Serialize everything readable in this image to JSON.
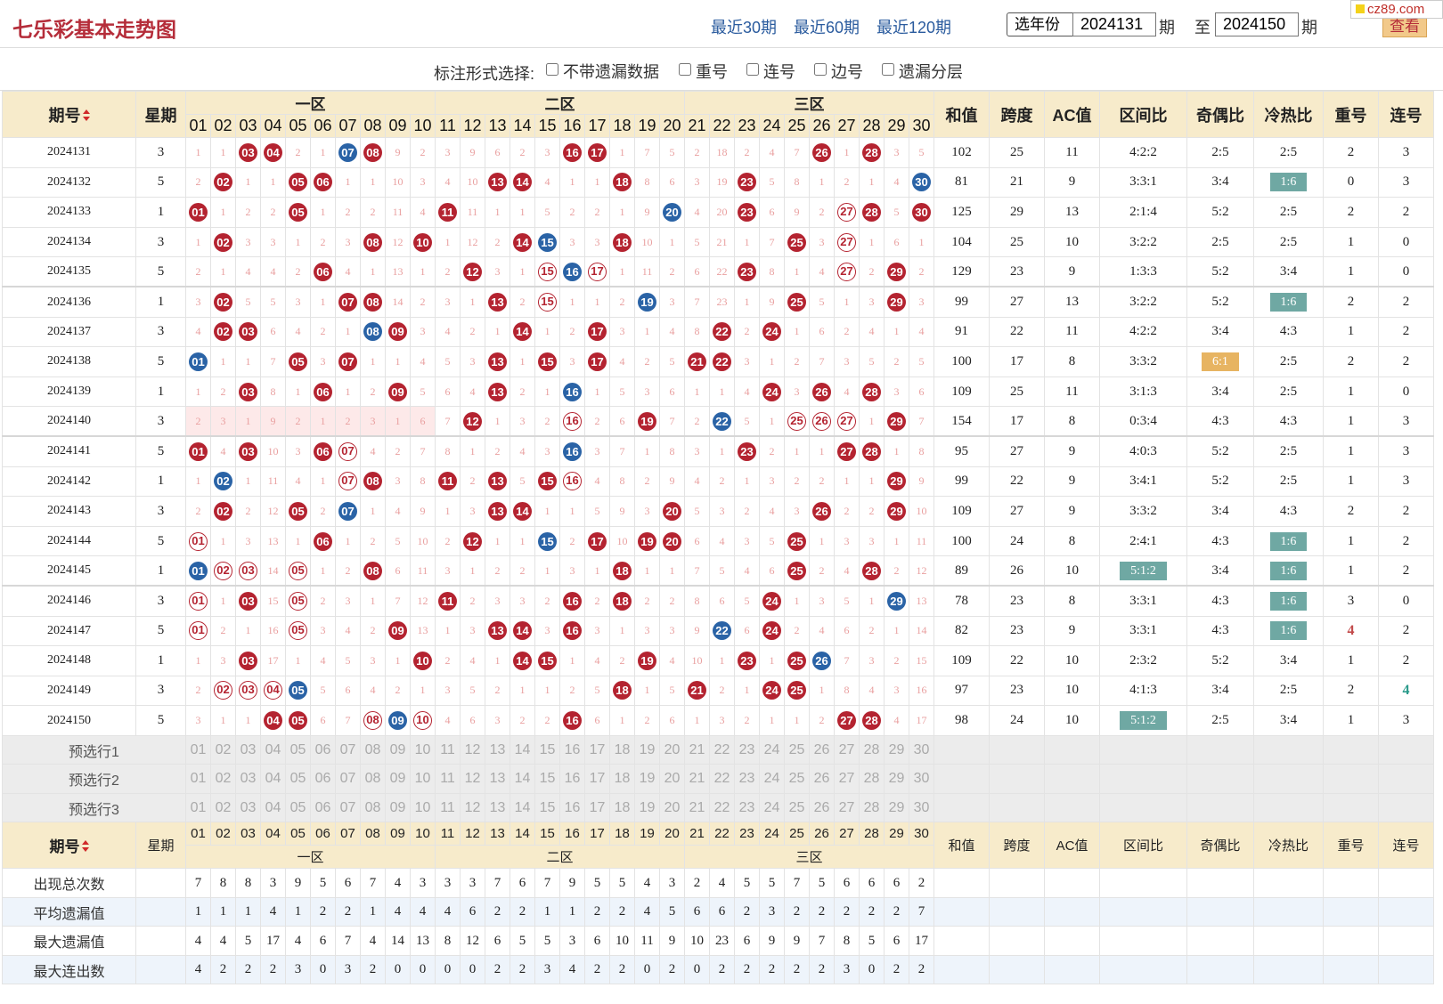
{
  "header": {
    "title": "七乐彩基本走势图",
    "link30": "最近30期",
    "link60": "最近60期",
    "link120": "最近120期",
    "year_select": "选年份",
    "from_period": "2024131",
    "period_label": "期",
    "to_label": "至",
    "to_period": "2024150",
    "period_label2": "期",
    "query_button": "查看",
    "watermark": "cz89.com"
  },
  "options": {
    "label": "标注形式选择:",
    "items": [
      "不带遗漏数据",
      "重号",
      "连号",
      "边号",
      "遗漏分层"
    ]
  },
  "table": {
    "h_period": "期号",
    "h_week": "星期",
    "zones": [
      "一区",
      "二区",
      "三区"
    ],
    "h_stats": [
      "和值",
      "跨度",
      "AC值",
      "区间比",
      "奇偶比",
      "冷热比",
      "重号",
      "连号"
    ],
    "nums": [
      "01",
      "02",
      "03",
      "04",
      "05",
      "06",
      "07",
      "08",
      "09",
      "10",
      "11",
      "12",
      "13",
      "14",
      "15",
      "16",
      "17",
      "18",
      "19",
      "20",
      "21",
      "22",
      "23",
      "24",
      "25",
      "26",
      "27",
      "28",
      "29",
      "30"
    ],
    "rows": [
      {
        "p": "2024131",
        "w": "3",
        "c": [
          "1",
          "1",
          "r03",
          "r04",
          "2",
          "1",
          "b07",
          "r08",
          "9",
          "2",
          "3",
          "9",
          "6",
          "2",
          "3",
          "r16",
          "r17",
          "1",
          "7",
          "5",
          "2",
          "18",
          "2",
          "4",
          "7",
          "r26",
          "1",
          "r28",
          "3",
          "5"
        ],
        "s": [
          "102",
          "25",
          "11",
          "4:2:2",
          "2:5",
          "2:5",
          "2",
          "3"
        ]
      },
      {
        "p": "2024132",
        "w": "5",
        "c": [
          "2",
          "r02",
          "1",
          "1",
          "r05",
          "r06",
          "1",
          "1",
          "10",
          "3",
          "4",
          "10",
          "r13",
          "r14",
          "4",
          "1",
          "1",
          "r18",
          "8",
          "6",
          "3",
          "19",
          "r23",
          "5",
          "8",
          "1",
          "2",
          "1",
          "4",
          "b30"
        ],
        "s": [
          "81",
          "21",
          "9",
          "3:3:1",
          "3:4",
          "t1:6",
          "0",
          "3"
        ]
      },
      {
        "p": "2024133",
        "w": "1",
        "c": [
          "r01",
          "1",
          "2",
          "2",
          "r05",
          "1",
          "2",
          "2",
          "11",
          "4",
          "r11",
          "11",
          "1",
          "1",
          "5",
          "2",
          "2",
          "1",
          "9",
          "b20",
          "4",
          "20",
          "r23",
          "6",
          "9",
          "2",
          "o27",
          "r28",
          "5",
          "r30"
        ],
        "s": [
          "125",
          "29",
          "13",
          "2:1:4",
          "5:2",
          "2:5",
          "2",
          "2"
        ]
      },
      {
        "p": "2024134",
        "w": "3",
        "c": [
          "1",
          "r02",
          "3",
          "3",
          "1",
          "2",
          "3",
          "r08",
          "12",
          "r10",
          "1",
          "12",
          "2",
          "r14",
          "b15",
          "3",
          "3",
          "r18",
          "10",
          "1",
          "5",
          "21",
          "1",
          "7",
          "r25",
          "3",
          "o27",
          "1",
          "6",
          "1"
        ],
        "s": [
          "104",
          "25",
          "10",
          "3:2:2",
          "2:5",
          "2:5",
          "1",
          "0"
        ]
      },
      {
        "p": "2024135",
        "w": "5",
        "c": [
          "2",
          "1",
          "4",
          "4",
          "2",
          "r06",
          "4",
          "1",
          "13",
          "1",
          "2",
          "r12",
          "3",
          "1",
          "o15",
          "b16",
          "o17",
          "1",
          "11",
          "2",
          "6",
          "22",
          "r23",
          "8",
          "1",
          "4",
          "o27",
          "2",
          "r29",
          "2"
        ],
        "s": [
          "129",
          "23",
          "9",
          "1:3:3",
          "5:2",
          "3:4",
          "1",
          "0"
        ]
      },
      {
        "p": "2024136",
        "w": "1",
        "c": [
          "3",
          "r02",
          "5",
          "5",
          "3",
          "1",
          "r07",
          "r08",
          "14",
          "2",
          "3",
          "1",
          "r13",
          "2",
          "o15",
          "1",
          "1",
          "2",
          "b19",
          "3",
          "7",
          "23",
          "1",
          "9",
          "r25",
          "5",
          "1",
          "3",
          "r29",
          "3"
        ],
        "s": [
          "99",
          "27",
          "13",
          "3:2:2",
          "5:2",
          "t1:6",
          "2",
          "2"
        ]
      },
      {
        "p": "2024137",
        "w": "3",
        "c": [
          "4",
          "r02",
          "r03",
          "6",
          "4",
          "2",
          "1",
          "b08",
          "r09",
          "3",
          "4",
          "2",
          "1",
          "r14",
          "1",
          "2",
          "r17",
          "3",
          "1",
          "4",
          "8",
          "r22",
          "2",
          "r24",
          "1",
          "6",
          "2",
          "4",
          "1",
          "4"
        ],
        "s": [
          "91",
          "22",
          "11",
          "4:2:2",
          "3:4",
          "4:3",
          "1",
          "2"
        ]
      },
      {
        "p": "2024138",
        "w": "5",
        "c": [
          "b01",
          "1",
          "1",
          "7",
          "r05",
          "3",
          "r07",
          "1",
          "1",
          "4",
          "5",
          "3",
          "r13",
          "1",
          "r15",
          "3",
          "r17",
          "4",
          "2",
          "5",
          "r21",
          "r22",
          "3",
          "1",
          "2",
          "7",
          "3",
          "5",
          "2",
          "5"
        ],
        "s": [
          "100",
          "17",
          "8",
          "3:3:2",
          "y6:1",
          "2:5",
          "2",
          "2"
        ]
      },
      {
        "p": "2024139",
        "w": "1",
        "c": [
          "1",
          "2",
          "r03",
          "8",
          "1",
          "r06",
          "1",
          "2",
          "r09",
          "5",
          "6",
          "4",
          "r13",
          "2",
          "1",
          "b16",
          "1",
          "5",
          "3",
          "6",
          "1",
          "1",
          "4",
          "r24",
          "3",
          "r26",
          "4",
          "r28",
          "3",
          "6"
        ],
        "s": [
          "109",
          "25",
          "11",
          "3:1:3",
          "3:4",
          "2:5",
          "1",
          "0"
        ]
      },
      {
        "p": "2024140",
        "w": "3",
        "h": true,
        "c": [
          "2",
          "3",
          "1",
          "9",
          "2",
          "1",
          "2",
          "3",
          "1",
          "6",
          "7",
          "r12",
          "1",
          "3",
          "2",
          "o16",
          "2",
          "6",
          "r19",
          "7",
          "2",
          "b22",
          "5",
          "1",
          "o25",
          "o26",
          "o27",
          "1",
          "r29",
          "7"
        ],
        "s": [
          "154",
          "17",
          "8",
          "0:3:4",
          "4:3",
          "4:3",
          "1",
          "3"
        ]
      },
      {
        "p": "2024141",
        "w": "5",
        "c": [
          "r01",
          "4",
          "r03",
          "10",
          "3",
          "r06",
          "o07",
          "4",
          "2",
          "7",
          "8",
          "1",
          "2",
          "4",
          "3",
          "b16",
          "3",
          "7",
          "1",
          "8",
          "3",
          "1",
          "r23",
          "2",
          "1",
          "1",
          "r27",
          "r28",
          "1",
          "8"
        ],
        "s": [
          "95",
          "27",
          "9",
          "4:0:3",
          "5:2",
          "2:5",
          "1",
          "3"
        ]
      },
      {
        "p": "2024142",
        "w": "1",
        "c": [
          "1",
          "b02",
          "1",
          "11",
          "4",
          "1",
          "o07",
          "r08",
          "3",
          "8",
          "r11",
          "2",
          "r13",
          "5",
          "r15",
          "o16",
          "4",
          "8",
          "2",
          "9",
          "4",
          "2",
          "1",
          "3",
          "2",
          "2",
          "1",
          "1",
          "r29",
          "9"
        ],
        "s": [
          "99",
          "22",
          "9",
          "3:4:1",
          "5:2",
          "2:5",
          "1",
          "3"
        ]
      },
      {
        "p": "2024143",
        "w": "3",
        "c": [
          "2",
          "r02",
          "2",
          "12",
          "r05",
          "2",
          "b07",
          "1",
          "4",
          "9",
          "1",
          "3",
          "r13",
          "r14",
          "1",
          "1",
          "5",
          "9",
          "3",
          "r20",
          "5",
          "3",
          "2",
          "4",
          "3",
          "r26",
          "2",
          "2",
          "r29",
          "10"
        ],
        "s": [
          "109",
          "27",
          "9",
          "3:3:2",
          "3:4",
          "4:3",
          "2",
          "2"
        ]
      },
      {
        "p": "2024144",
        "w": "5",
        "c": [
          "o01",
          "1",
          "3",
          "13",
          "1",
          "r06",
          "1",
          "2",
          "5",
          "10",
          "2",
          "r12",
          "1",
          "1",
          "b15",
          "2",
          "r17",
          "10",
          "r19",
          "r20",
          "6",
          "4",
          "3",
          "5",
          "r25",
          "1",
          "3",
          "3",
          "1",
          "11"
        ],
        "s": [
          "100",
          "24",
          "8",
          "2:4:1",
          "4:3",
          "t1:6",
          "1",
          "2"
        ]
      },
      {
        "p": "2024145",
        "w": "1",
        "c": [
          "b01",
          "o02",
          "o03",
          "14",
          "o05",
          "1",
          "2",
          "r08",
          "6",
          "11",
          "3",
          "1",
          "2",
          "2",
          "1",
          "3",
          "1",
          "r18",
          "1",
          "1",
          "7",
          "5",
          "4",
          "6",
          "r25",
          "2",
          "4",
          "r28",
          "2",
          "12"
        ],
        "s": [
          "89",
          "26",
          "10",
          "t5:1:2",
          "3:4",
          "t1:6",
          "1",
          "2"
        ]
      },
      {
        "p": "2024146",
        "w": "3",
        "c": [
          "o01",
          "1",
          "r03",
          "15",
          "o05",
          "2",
          "3",
          "1",
          "7",
          "12",
          "r11",
          "2",
          "3",
          "3",
          "2",
          "r16",
          "2",
          "r18",
          "2",
          "2",
          "8",
          "6",
          "5",
          "r24",
          "1",
          "3",
          "5",
          "1",
          "b29",
          "13"
        ],
        "s": [
          "78",
          "23",
          "8",
          "3:3:1",
          "4:3",
          "t1:6",
          "3",
          "0"
        ]
      },
      {
        "p": "2024147",
        "w": "5",
        "c": [
          "o01",
          "2",
          "1",
          "16",
          "o05",
          "3",
          "4",
          "2",
          "r09",
          "13",
          "1",
          "3",
          "r13",
          "r14",
          "3",
          "r16",
          "3",
          "1",
          "3",
          "3",
          "9",
          "b22",
          "6",
          "r24",
          "2",
          "4",
          "6",
          "2",
          "1",
          "14"
        ],
        "s": [
          "82",
          "23",
          "9",
          "3:3:1",
          "4:3",
          "t1:6",
          "R4",
          "2"
        ]
      },
      {
        "p": "2024148",
        "w": "1",
        "c": [
          "1",
          "3",
          "r03",
          "17",
          "1",
          "4",
          "5",
          "3",
          "1",
          "r10",
          "2",
          "4",
          "1",
          "r14",
          "r15",
          "1",
          "4",
          "2",
          "r19",
          "4",
          "10",
          "1",
          "r23",
          "1",
          "r25",
          "b26",
          "7",
          "3",
          "2",
          "15"
        ],
        "s": [
          "109",
          "22",
          "10",
          "2:3:2",
          "5:2",
          "3:4",
          "1",
          "2"
        ]
      },
      {
        "p": "2024149",
        "w": "3",
        "c": [
          "2",
          "o02",
          "o03",
          "o04",
          "b05",
          "5",
          "6",
          "4",
          "2",
          "1",
          "3",
          "5",
          "2",
          "1",
          "1",
          "2",
          "5",
          "r18",
          "1",
          "5",
          "r21",
          "2",
          "1",
          "r24",
          "r25",
          "1",
          "8",
          "4",
          "3",
          "16"
        ],
        "s": [
          "97",
          "23",
          "10",
          "4:1:3",
          "3:4",
          "2:5",
          "2",
          "G4"
        ]
      },
      {
        "p": "2024150",
        "w": "5",
        "c": [
          "3",
          "1",
          "1",
          "r04",
          "r05",
          "6",
          "7",
          "o08",
          "b09",
          "o10",
          "4",
          "6",
          "3",
          "2",
          "2",
          "r16",
          "6",
          "1",
          "2",
          "6",
          "1",
          "3",
          "2",
          "1",
          "1",
          "2",
          "r27",
          "r28",
          "4",
          "17"
        ],
        "s": [
          "98",
          "24",
          "10",
          "t5:1:2",
          "2:5",
          "3:4",
          "1",
          "3"
        ]
      }
    ],
    "pre_labels": [
      "预选行1",
      "预选行2",
      "预选行3"
    ],
    "stat_rows": [
      {
        "label": "出现总次数",
        "v": [
          "7",
          "8",
          "8",
          "3",
          "9",
          "5",
          "6",
          "7",
          "4",
          "3",
          "3",
          "3",
          "7",
          "6",
          "7",
          "9",
          "5",
          "5",
          "4",
          "3",
          "2",
          "4",
          "5",
          "5",
          "7",
          "5",
          "6",
          "6",
          "6",
          "2"
        ]
      },
      {
        "label": "平均遗漏值",
        "v": [
          "1",
          "1",
          "1",
          "4",
          "1",
          "2",
          "2",
          "1",
          "4",
          "4",
          "4",
          "6",
          "2",
          "2",
          "1",
          "1",
          "2",
          "2",
          "4",
          "5",
          "6",
          "6",
          "2",
          "3",
          "2",
          "2",
          "2",
          "2",
          "2",
          "7"
        ]
      },
      {
        "label": "最大遗漏值",
        "v": [
          "4",
          "4",
          "5",
          "17",
          "4",
          "6",
          "7",
          "4",
          "14",
          "13",
          "8",
          "12",
          "6",
          "5",
          "5",
          "3",
          "6",
          "10",
          "11",
          "9",
          "10",
          "23",
          "6",
          "9",
          "9",
          "7",
          "8",
          "5",
          "6",
          "17"
        ]
      },
      {
        "label": "最大连出数",
        "v": [
          "4",
          "2",
          "2",
          "2",
          "3",
          "0",
          "3",
          "2",
          "0",
          "0",
          "0",
          "0",
          "2",
          "2",
          "3",
          "4",
          "2",
          "2",
          "0",
          "2",
          "0",
          "2",
          "2",
          "2",
          "2",
          "2",
          "3",
          "0",
          "2",
          "2"
        ]
      }
    ]
  },
  "colors": {
    "red_ball": "#b42330",
    "blue_ball": "#2a63a6",
    "teal_tag": "#6fa8a3",
    "yellow_tag": "#e7b462",
    "header_bg": "#f7ebcb",
    "title": "#b52d3a"
  }
}
